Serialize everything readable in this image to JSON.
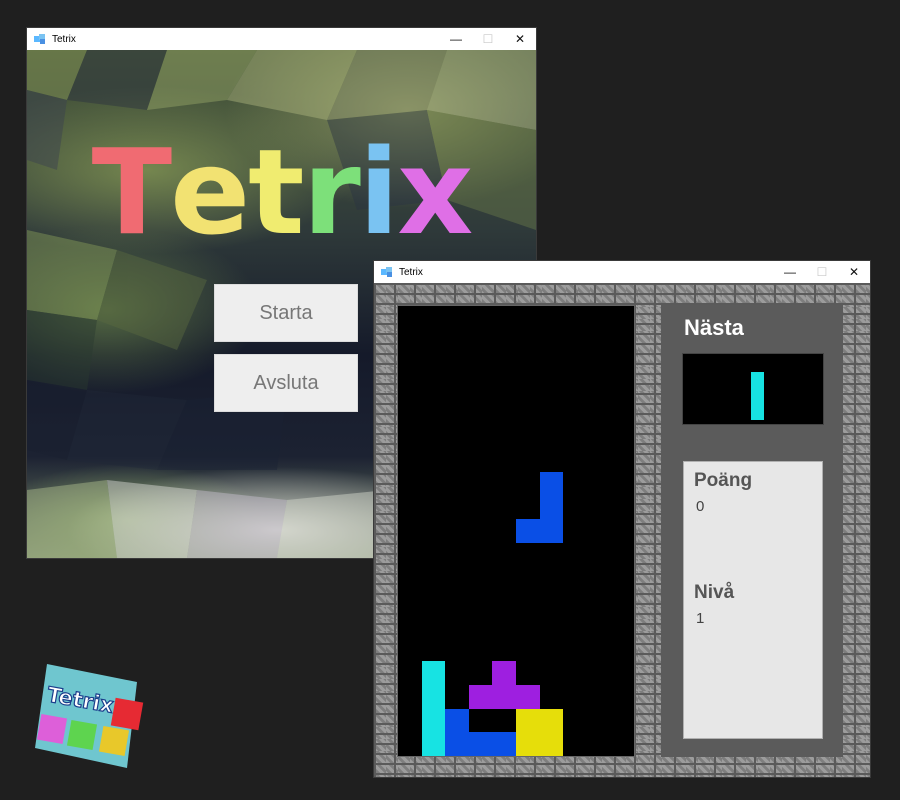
{
  "menu_window": {
    "title": "Tetrix",
    "controls": {
      "minimize": "—",
      "maximize": "☐",
      "close": "✕"
    },
    "logo_letters": [
      {
        "char": "T",
        "color": "#f06b72"
      },
      {
        "char": "e",
        "color": "#f2e272"
      },
      {
        "char": "t",
        "color": "#f0ec70"
      },
      {
        "char": "r",
        "color": "#7de07a"
      },
      {
        "char": "i",
        "color": "#7ac3f2"
      },
      {
        "char": "x",
        "color": "#df6fe6"
      }
    ],
    "buttons": {
      "start": "Starta",
      "quit": "Avsluta"
    }
  },
  "game_window": {
    "title": "Tetrix",
    "controls": {
      "minimize": "—",
      "maximize": "☐",
      "close": "✕"
    },
    "next_label": "Nästa",
    "score_label": "Poäng",
    "score_value": "0",
    "level_label": "Nivå",
    "level_value": "1",
    "next_piece": {
      "type": "I",
      "color": "#17e3e3"
    },
    "board": {
      "cols": 10,
      "rows": 19,
      "colors": {
        "I": "#17e3e3",
        "J": "#0a4fe6",
        "T": "#9e1fe0",
        "O": "#e6de0a"
      },
      "cells": [
        {
          "c": 6,
          "r": 7,
          "p": "J"
        },
        {
          "c": 6,
          "r": 8,
          "p": "J"
        },
        {
          "c": 5,
          "r": 9,
          "p": "J"
        },
        {
          "c": 6,
          "r": 9,
          "p": "J"
        },
        {
          "c": 1,
          "r": 15,
          "p": "I"
        },
        {
          "c": 1,
          "r": 16,
          "p": "I"
        },
        {
          "c": 1,
          "r": 17,
          "p": "I"
        },
        {
          "c": 1,
          "r": 18,
          "p": "I"
        },
        {
          "c": 4,
          "r": 15,
          "p": "T"
        },
        {
          "c": 3,
          "r": 16,
          "p": "T"
        },
        {
          "c": 4,
          "r": 16,
          "p": "T"
        },
        {
          "c": 5,
          "r": 16,
          "p": "T"
        },
        {
          "c": 2,
          "r": 17,
          "p": "J"
        },
        {
          "c": 2,
          "r": 18,
          "p": "J"
        },
        {
          "c": 3,
          "r": 18,
          "p": "J"
        },
        {
          "c": 4,
          "r": 18,
          "p": "J"
        },
        {
          "c": 5,
          "r": 17,
          "p": "O"
        },
        {
          "c": 6,
          "r": 17,
          "p": "O"
        },
        {
          "c": 5,
          "r": 18,
          "p": "O"
        },
        {
          "c": 6,
          "r": 18,
          "p": "O"
        }
      ]
    }
  },
  "app_logo": {
    "text": "Tetrix",
    "colors": {
      "bg": "#6fc6cf",
      "red": "#e62a33",
      "pink": "#dd5fd9",
      "green": "#5ed44f",
      "yellow": "#e8c82a"
    }
  }
}
